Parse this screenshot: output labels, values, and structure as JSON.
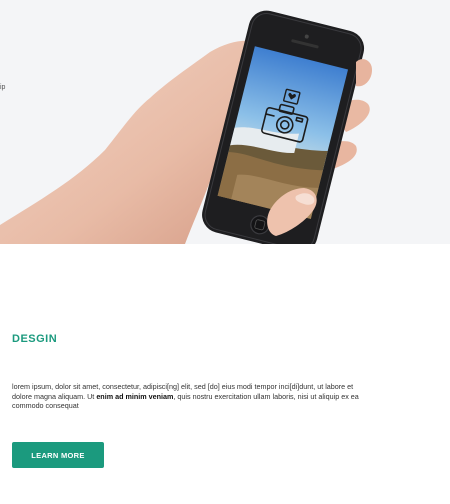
{
  "hero": {
    "cropped_text": "ip"
  },
  "feature": {
    "title": "DESGIN",
    "body_part1": "lorem ipsum, dolor sit amet, consectetur, adipisci[ng] elit, sed [do] eius modi tempor inci[di]dunt, ut labore et dolore magna aliquam. Ut ",
    "body_bold": "enim ad minim veniam",
    "body_part2": ", quis nostru exercitation ullam laboris, nisi ut aliquip ex ea commodo consequat",
    "button_label": "LEARN MORE"
  },
  "colors": {
    "accent": "#1b9a7e",
    "hero_background": "#f4f5f7",
    "phone_body": "#1e1e20"
  },
  "icons": [
    "camera-icon",
    "heart-icon"
  ]
}
